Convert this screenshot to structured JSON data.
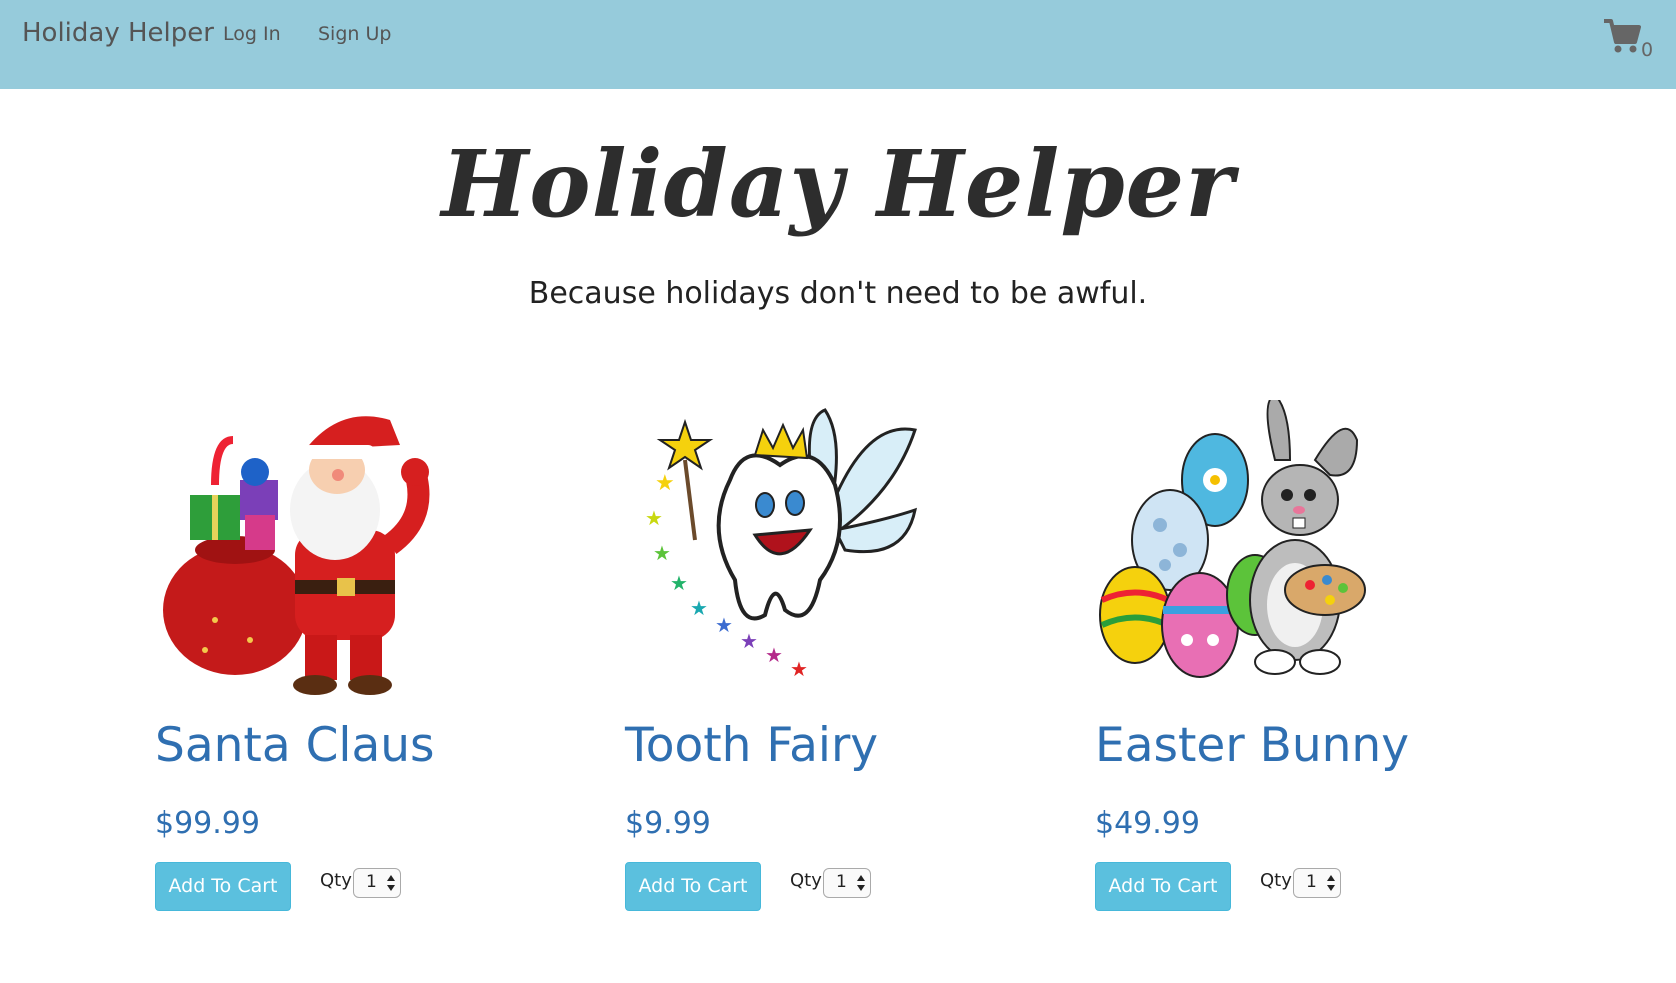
{
  "nav": {
    "brand": "Holiday Helper",
    "login": "Log In",
    "signup": "Sign Up",
    "cart_count": "0"
  },
  "hero": {
    "title": "Holiday Helper",
    "subtitle": "Because holidays don't need to be awful."
  },
  "products": [
    {
      "name": "Santa Claus",
      "price": "$99.99",
      "button": "Add To Cart",
      "qty_label": "Qty",
      "qty_value": "1",
      "image_icon": "santa-claus-image"
    },
    {
      "name": "Tooth Fairy",
      "price": "$9.99",
      "button": "Add To Cart",
      "qty_label": "Qty",
      "qty_value": "1",
      "image_icon": "tooth-fairy-image"
    },
    {
      "name": "Easter Bunny",
      "price": "$49.99",
      "button": "Add To Cart",
      "qty_label": "Qty",
      "qty_value": "1",
      "image_icon": "easter-bunny-image"
    }
  ],
  "colors": {
    "navbar": "#96cbdb",
    "product_text": "#2f6fb1",
    "button": "#5bc0de"
  }
}
